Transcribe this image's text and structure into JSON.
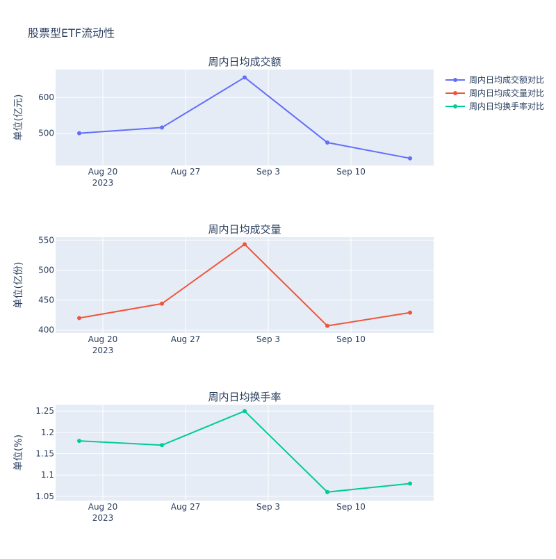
{
  "title": "股票型ETF流动性",
  "colors": {
    "plot_bg": "#e5ecf6",
    "grid": "#ffffff",
    "text": "#2a3f5f",
    "series": [
      "#636efa",
      "#ef553b",
      "#00cc96"
    ]
  },
  "legend": {
    "placement": "top-right",
    "entries": [
      "周内日均成交额对比",
      "周内日均成交量对比",
      "周内日均换手率对比"
    ]
  },
  "chart_data": [
    {
      "type": "line",
      "title": "周内日均成交额",
      "ylabel": "单位(亿元)",
      "xlabel": "",
      "x": [
        "2023-08-18",
        "2023-08-25",
        "2023-09-01",
        "2023-09-08",
        "2023-09-15"
      ],
      "xlim": [
        "2023-08-16",
        "2023-09-17"
      ],
      "xticks": [
        "2023-08-20",
        "2023-08-27",
        "2023-09-03",
        "2023-09-10"
      ],
      "xtick_labels": [
        "Aug 20",
        "Aug 27",
        "Sep 3",
        "Sep 10"
      ],
      "x_year_label": "2023",
      "ylim": [
        410,
        678
      ],
      "yticks": [
        500,
        600
      ],
      "ytick_labels": [
        "500",
        "600"
      ],
      "grid": true,
      "series": [
        {
          "name": "周内日均成交额对比",
          "values": [
            500,
            516,
            656,
            474,
            430
          ]
        }
      ]
    },
    {
      "type": "line",
      "title": "周内日均成交量",
      "ylabel": "单位(亿份)",
      "xlabel": "",
      "x": [
        "2023-08-18",
        "2023-08-25",
        "2023-09-01",
        "2023-09-08",
        "2023-09-15"
      ],
      "xlim": [
        "2023-08-16",
        "2023-09-17"
      ],
      "xticks": [
        "2023-08-20",
        "2023-08-27",
        "2023-09-03",
        "2023-09-10"
      ],
      "xtick_labels": [
        "Aug 20",
        "Aug 27",
        "Sep 3",
        "Sep 10"
      ],
      "x_year_label": "2023",
      "ylim": [
        395,
        555
      ],
      "yticks": [
        400,
        450,
        500,
        550
      ],
      "ytick_labels": [
        "400",
        "450",
        "500",
        "550"
      ],
      "grid": true,
      "series": [
        {
          "name": "周内日均成交量对比",
          "values": [
            420,
            444,
            543,
            407,
            429
          ]
        }
      ]
    },
    {
      "type": "line",
      "title": "周内日均换手率",
      "ylabel": "单位(%)",
      "xlabel": "",
      "x": [
        "2023-08-18",
        "2023-08-25",
        "2023-09-01",
        "2023-09-08",
        "2023-09-15"
      ],
      "xlim": [
        "2023-08-16",
        "2023-09-17"
      ],
      "xticks": [
        "2023-08-20",
        "2023-08-27",
        "2023-09-03",
        "2023-09-10"
      ],
      "xtick_labels": [
        "Aug 20",
        "Aug 27",
        "Sep 3",
        "Sep 10"
      ],
      "x_year_label": "2023",
      "ylim": [
        1.04,
        1.265
      ],
      "yticks": [
        1.05,
        1.1,
        1.15,
        1.2,
        1.25
      ],
      "ytick_labels": [
        "1.05",
        "1.1",
        "1.15",
        "1.2",
        "1.25"
      ],
      "grid": true,
      "series": [
        {
          "name": "周内日均换手率对比",
          "values": [
            1.18,
            1.17,
            1.25,
            1.06,
            1.08
          ]
        }
      ]
    }
  ]
}
